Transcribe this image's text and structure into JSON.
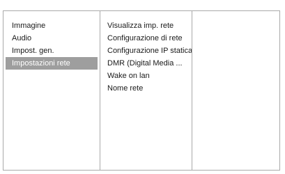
{
  "menu": {
    "level1": [
      {
        "label": "Immagine"
      },
      {
        "label": "Audio"
      },
      {
        "label": "Impost. gen."
      },
      {
        "label": "Impostazioni rete",
        "selected": true
      }
    ],
    "level2": [
      {
        "label": "Visualizza imp. rete"
      },
      {
        "label": "Configurazione di rete"
      },
      {
        "label": "Configurazione IP statica"
      },
      {
        "label": "DMR (Digital Media ..."
      },
      {
        "label": "Wake on lan"
      },
      {
        "label": "Nome rete"
      }
    ]
  },
  "colors": {
    "selected_bg": "#9e9e9e",
    "selected_text": "#ffffff",
    "border": "#a9a9a9"
  }
}
